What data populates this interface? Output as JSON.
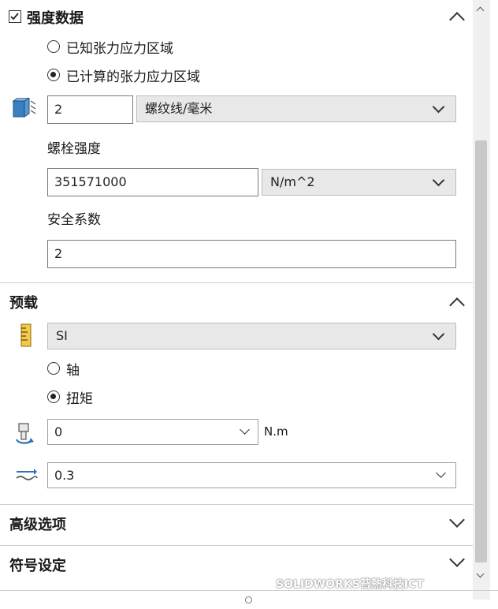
{
  "strength": {
    "title": "强度数据",
    "checked": true,
    "radio_known": "已知张力应力区域",
    "radio_calc": "已计算的张力应力区域",
    "thread_value": "2",
    "thread_unit": "螺纹线/毫米",
    "bolt_strength_label": "螺栓强度",
    "bolt_strength_value": "351571000",
    "bolt_strength_unit": "N/m^2",
    "safety_label": "安全系数",
    "safety_value": "2"
  },
  "preload": {
    "title": "预载",
    "unit_system": "SI",
    "radio_axial": "轴",
    "radio_torque": "扭矩",
    "torque_value": "0",
    "torque_unit": "N.m",
    "friction_value": "0.3"
  },
  "advanced": {
    "title": "高级选项"
  },
  "symbol": {
    "title": "符号设定"
  },
  "watermark": "SOLIDWORKS苔熱科技ICT"
}
